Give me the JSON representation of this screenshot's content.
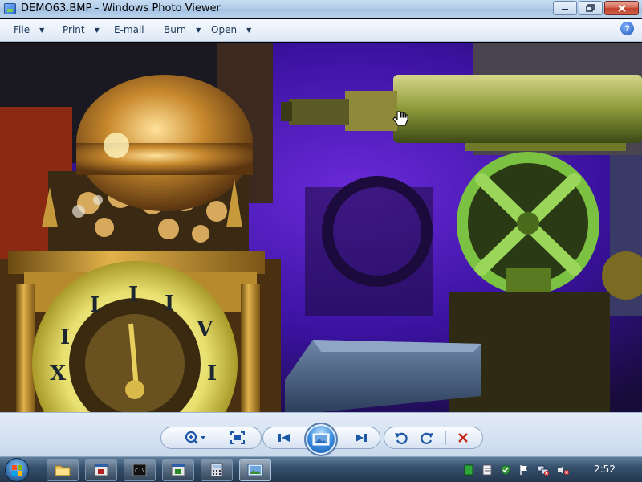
{
  "window": {
    "title": "DEMO63.BMP - Windows Photo Viewer"
  },
  "menu": {
    "items": [
      {
        "label": "File",
        "has_dropdown": true
      },
      {
        "label": "Print",
        "has_dropdown": true
      },
      {
        "label": "E-mail",
        "has_dropdown": false
      },
      {
        "label": "Burn",
        "has_dropdown": true
      },
      {
        "label": "Open",
        "has_dropdown": true
      }
    ],
    "help_label": "?"
  },
  "controls": {
    "zoom_icon": "magnifier-zoom-icon",
    "actual_size_icon": "fit-to-window-icon",
    "previous_icon": "previous-icon",
    "slideshow_icon": "slideshow-icon",
    "next_icon": "next-icon",
    "rotate_ccw_icon": "rotate-counterclockwise-icon",
    "rotate_cw_icon": "rotate-clockwise-icon",
    "delete_icon": "delete-icon"
  },
  "taskbar": {
    "clock": "2:52",
    "buttons": [
      "windows-explorer",
      "app-window",
      "command-prompt",
      "app-window-green",
      "calculator",
      "photo-viewer"
    ]
  },
  "colors": {
    "accent": "#1b57a6",
    "delete": "#c4281c",
    "titlebar": "#b2cde9"
  }
}
